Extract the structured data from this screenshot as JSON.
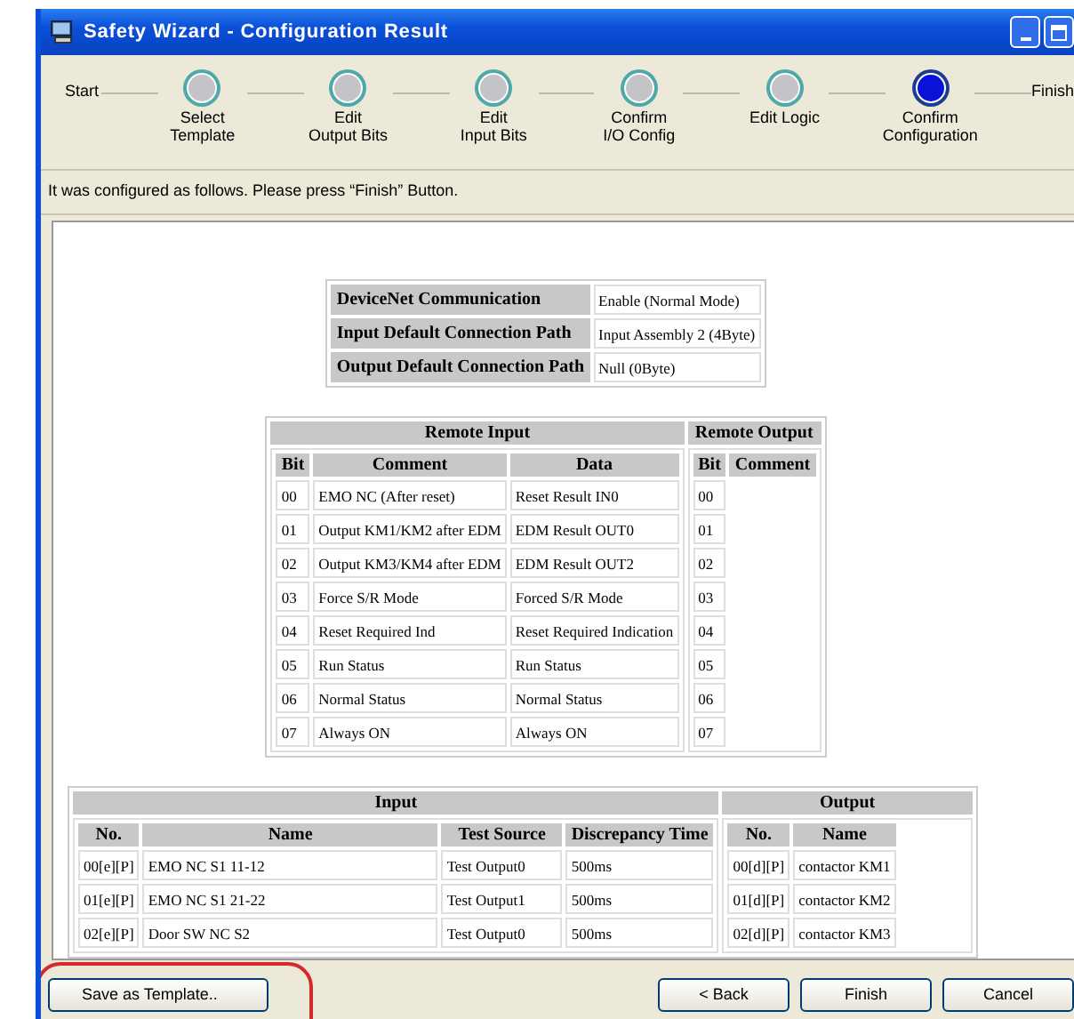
{
  "window": {
    "title": "Safety Wizard - Configuration Result"
  },
  "wizard": {
    "steps": [
      {
        "label": "Start",
        "kind": "endpoint"
      },
      {
        "label": "Select\nTemplate",
        "kind": "step",
        "selected": false
      },
      {
        "label": "Edit\nOutput Bits",
        "kind": "step",
        "selected": false
      },
      {
        "label": "Edit\nInput Bits",
        "kind": "step",
        "selected": false
      },
      {
        "label": "Confirm\nI/O Config",
        "kind": "step",
        "selected": false
      },
      {
        "label": "Edit Logic",
        "kind": "step",
        "selected": false
      },
      {
        "label": "Confirm\nConfiguration",
        "kind": "step",
        "selected": true
      },
      {
        "label": "Finish",
        "kind": "endpoint"
      }
    ]
  },
  "message": "It was configured as follows. Please press “Finish” Button.",
  "summary": [
    {
      "label": "DeviceNet Communication",
      "value": "Enable (Normal Mode)"
    },
    {
      "label": "Input Default Connection Path",
      "value": "Input Assembly 2 (4Byte)"
    },
    {
      "label": "Output Default Connection Path",
      "value": "Null (0Byte)"
    }
  ],
  "remote_input": {
    "title": "Remote Input",
    "columns": [
      "Bit",
      "Comment",
      "Data"
    ],
    "rows": [
      [
        "00",
        "EMO NC (After reset)",
        "Reset Result IN0"
      ],
      [
        "01",
        "Output KM1/KM2 after EDM",
        "EDM Result OUT0"
      ],
      [
        "02",
        "Output KM3/KM4 after EDM",
        "EDM Result OUT2"
      ],
      [
        "03",
        "Force S/R Mode",
        "Forced S/R Mode"
      ],
      [
        "04",
        "Reset Required Ind",
        "Reset Required Indication"
      ],
      [
        "05",
        "Run Status",
        "Run Status"
      ],
      [
        "06",
        "Normal Status",
        "Normal Status"
      ],
      [
        "07",
        "Always ON",
        "Always ON"
      ]
    ]
  },
  "remote_output": {
    "title": "Remote Output",
    "columns": [
      "Bit",
      "Comment"
    ],
    "rows": [
      [
        "00"
      ],
      [
        "01"
      ],
      [
        "02"
      ],
      [
        "03"
      ],
      [
        "04"
      ],
      [
        "05"
      ],
      [
        "06"
      ],
      [
        "07"
      ]
    ]
  },
  "input": {
    "title": "Input",
    "columns": [
      "No.",
      "Name",
      "Test Source",
      "Discrepancy Time"
    ],
    "rows": [
      [
        "00[e][P]",
        "EMO NC S1 11-12",
        "Test Output0",
        "500ms"
      ],
      [
        "01[e][P]",
        "EMO NC S1 21-22",
        "Test Output1",
        "500ms"
      ],
      [
        "02[e][P]",
        "Door SW NC S2",
        "Test Output0",
        "500ms"
      ]
    ]
  },
  "output": {
    "title": "Output",
    "columns": [
      "No.",
      "Name"
    ],
    "rows": [
      [
        "00[d][P]",
        "contactor KM1"
      ],
      [
        "01[d][P]",
        "contactor KM2"
      ],
      [
        "02[d][P]",
        "contactor KM3"
      ]
    ]
  },
  "buttons": [
    {
      "label": "Save as Template..",
      "kind": "left"
    },
    {
      "label": "< Back",
      "kind": "right"
    },
    {
      "label": "Finish",
      "kind": "right"
    },
    {
      "label": "Cancel",
      "kind": "right"
    }
  ],
  "annotation": {
    "kind": "outline",
    "color": "#d42a2a"
  }
}
